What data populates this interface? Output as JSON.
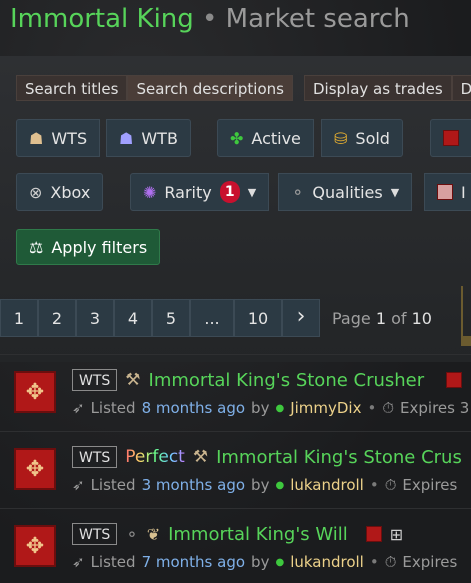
{
  "header": {
    "game": "Immortal King",
    "separator": " • ",
    "page": "Market search"
  },
  "toggles": {
    "search_titles": "Search titles",
    "search_descriptions": "Search descriptions",
    "display_as_trades": "Display as trades",
    "di_partial": "Di"
  },
  "filters": {
    "wts": "WTS",
    "wtb": "WTB",
    "active": "Active",
    "sold": "Sold",
    "xbox": "Xbox",
    "rarity": "Rarity",
    "rarity_count": "1",
    "qualities": "Qualities",
    "partial_i": "I",
    "apply": "Apply filters"
  },
  "pagination": {
    "pages": [
      "1",
      "2",
      "3",
      "4",
      "5",
      "...",
      "10"
    ],
    "next": "›",
    "label_page": "Page",
    "current": "1",
    "label_of": "of",
    "total": "10"
  },
  "listings": [
    {
      "tag": "WTS",
      "prefix": "",
      "name": "Immortal King's Stone Crusher",
      "listed_label": "Listed",
      "ago": "8 months ago",
      "by": "by",
      "user": "JimmyDix",
      "expires": "Expires 3"
    },
    {
      "tag": "WTS",
      "prefix": "Perfect",
      "name": "Immortal King's Stone Crus",
      "listed_label": "Listed",
      "ago": "3 months ago",
      "by": "by",
      "user": "lukandroll",
      "expires": "Expires"
    },
    {
      "tag": "WTS",
      "prefix": "",
      "name": "Immortal King's Will",
      "listed_label": "Listed",
      "ago": "7 months ago",
      "by": "by",
      "user": "lukandroll",
      "expires": "Expires"
    }
  ],
  "colors": {
    "game_green": "#57d45a",
    "button_blue": "#2c3a44",
    "apply_green": "#1f5a37",
    "badge_red": "#c8102e",
    "link_blue": "#7fb0e8",
    "user_gold": "#ecd18a"
  }
}
